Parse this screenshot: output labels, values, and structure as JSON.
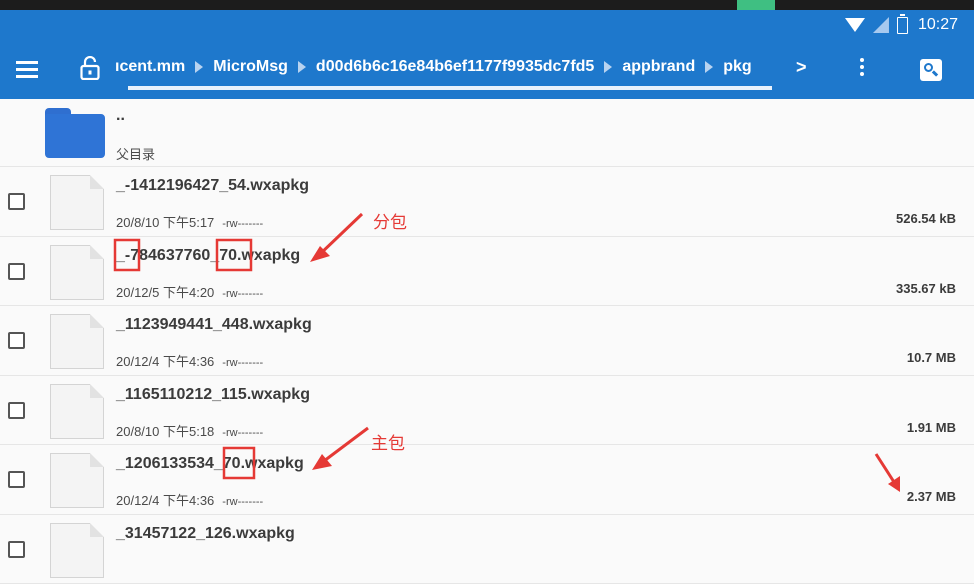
{
  "status_bar": {
    "time": "10:27",
    "icons": [
      "wifi-icon",
      "no-sim-icon",
      "battery-charging-icon"
    ]
  },
  "toolbar": {
    "breadcrumbs": [
      "ıcent.mm",
      "MicroMsg",
      "d00d6b6c16e84b6ef1177f9935dc7fd5",
      "appbrand",
      "pkg"
    ],
    "more_arrow": ">",
    "icons": [
      "menu-icon",
      "lock-open-icon",
      "chevron-right-icon",
      "more-vert-icon",
      "search-icon"
    ],
    "accent": "#1e78cc"
  },
  "parent_dir": {
    "name": "..",
    "label": "父目录"
  },
  "files": [
    {
      "name": "_-1412196427_54.wxapkg",
      "date": "20/8/10 下午5:17",
      "perm": "-rw-------",
      "size": "526.54 kB"
    },
    {
      "name": "_-784637760_70.wxapkg",
      "date": "20/12/5 下午4:20",
      "perm": "-rw-------",
      "size": "335.67 kB"
    },
    {
      "name": "_1123949441_448.wxapkg",
      "date": "20/12/4 下午4:36",
      "perm": "-rw-------",
      "size": "10.7 MB"
    },
    {
      "name": "_1165110212_115.wxapkg",
      "date": "20/8/10 下午5:18",
      "perm": "-rw-------",
      "size": "1.91 MB"
    },
    {
      "name": "_1206133534_70.wxapkg",
      "date": "20/12/4 下午4:36",
      "perm": "-rw-------",
      "size": "2.37 MB"
    },
    {
      "name": "_31457122_126.wxapkg",
      "date": "",
      "perm": "",
      "size": ""
    }
  ],
  "annotations": {
    "sub_package": "分包",
    "main_package": "主包",
    "color": "#e53935"
  }
}
